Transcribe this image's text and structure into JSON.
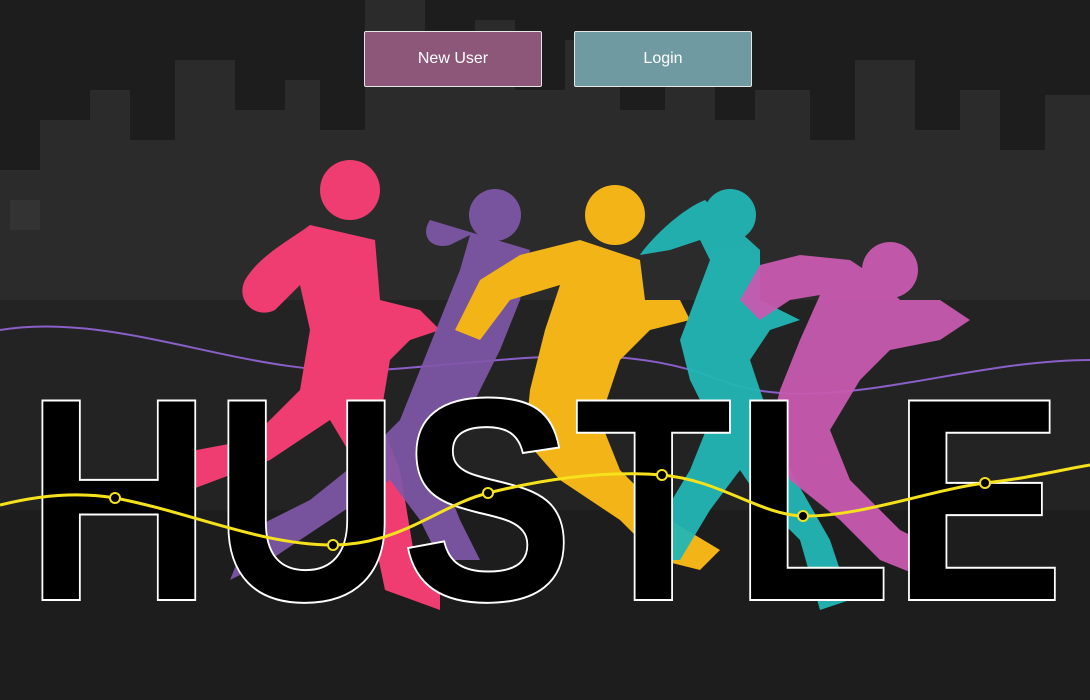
{
  "header": {
    "new_user_label": "New User",
    "login_label": "Login"
  },
  "hero": {
    "wordmark": "HUSTLE"
  },
  "colors": {
    "background": "#1d1d1d",
    "skyline": "#2c2c2c",
    "new_user_button": "#8d577a",
    "login_button": "#6f9aa1",
    "runner_pink": "#ef3d72",
    "runner_purple": "#7f57a8",
    "runner_yellow": "#f2b417",
    "runner_teal": "#22b6b4",
    "runner_magenta": "#c85ab0",
    "wave_yellow": "#f5e21c",
    "wave_purple": "#8a5fc8"
  }
}
